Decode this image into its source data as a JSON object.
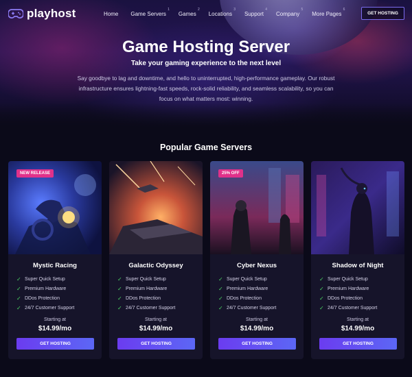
{
  "brand": {
    "name": "playhost",
    "logo_icon": "gamepad-icon"
  },
  "nav": {
    "items": [
      {
        "label": "Home",
        "sup": ""
      },
      {
        "label": "Game Servers",
        "sup": "1"
      },
      {
        "label": "Games",
        "sup": "2"
      },
      {
        "label": "Locations",
        "sup": "3"
      },
      {
        "label": "Support",
        "sup": "4"
      },
      {
        "label": "Company",
        "sup": "5"
      },
      {
        "label": "More Pages",
        "sup": "6"
      }
    ],
    "cta": "GET HOSTING"
  },
  "hero": {
    "title": "Game Hosting Server",
    "subtitle": "Take your gaming experience to the next level",
    "description": "Say goodbye to lag and downtime, and hello to uninterrupted, high-performance gameplay. Our robust infrastructure ensures lightning-fast speeds, rock-solid reliability, and seamless scalability, so you can focus on what matters most: winning."
  },
  "section": {
    "title": "Popular Game Servers"
  },
  "cards": [
    {
      "title": "Mystic Racing",
      "badge": "NEW RELEASE",
      "features": [
        "Super Quick Setup",
        "Premium Hardware",
        "DDos Protection",
        "24/7 Customer Support"
      ],
      "starting": "Starting at",
      "price": "$14.99/mo",
      "button": "GET HOSTING"
    },
    {
      "title": "Galactic Odyssey",
      "badge": "",
      "features": [
        "Super Quick Setup",
        "Premium Hardware",
        "DDos Protection",
        "24/7 Customer Support"
      ],
      "starting": "Starting at",
      "price": "$14.99/mo",
      "button": "GET HOSTING"
    },
    {
      "title": "Cyber Nexus",
      "badge": "25% OFF",
      "features": [
        "Super Quick Setup",
        "Premium Hardware",
        "DDos Protection",
        "24/7 Customer Support"
      ],
      "starting": "Starting at",
      "price": "$14.99/mo",
      "button": "GET HOSTING"
    },
    {
      "title": "Shadow of Night",
      "badge": "",
      "features": [
        "Super Quick Setup",
        "Premium Hardware",
        "DDos Protection",
        "24/7 Customer Support"
      ],
      "starting": "Starting at",
      "price": "$14.99/mo",
      "button": "GET HOSTING"
    }
  ],
  "colors": {
    "background": "#0b0a19",
    "card": "#16142a",
    "accent": "#6b3cf0",
    "badge": "#e0318a",
    "check": "#4cd964"
  }
}
